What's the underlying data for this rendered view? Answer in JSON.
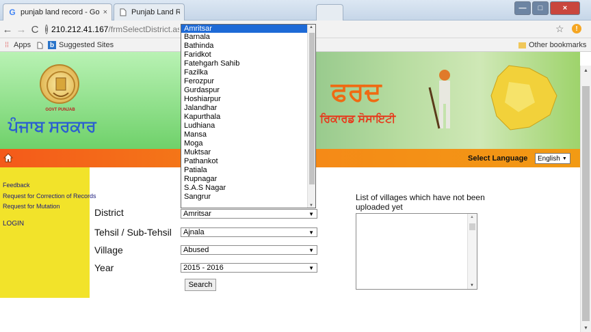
{
  "browser": {
    "tabs": [
      {
        "icon": "G",
        "label": "punjab land record - Go",
        "close": "×"
      },
      {
        "icon": "page",
        "label": "Punjab Land Record"
      }
    ],
    "window_controls": {
      "minimize": "—",
      "maximize": "□",
      "close": "×"
    },
    "url_host": "210.212.41.167",
    "url_path": "/frmSelectDistrict.asp",
    "bookmarks": [
      "Apps",
      "Suggested Sites"
    ],
    "other_bookmarks": "Other bookmarks"
  },
  "header": {
    "left_script": "ਪੰਜਾਬ ਸਰਕਾਰ",
    "right_script_top": "ਫਰਦ",
    "right_script_bottom": "ਰਿਕਾਰਡ ਸੋਸਾਇਟੀ",
    "emblem_caption": "GOVT PUNJAB"
  },
  "nav": {
    "select_language_label": "Select Language",
    "language_value": "English"
  },
  "sidebar": {
    "links": [
      "Feedback",
      "Request for Correction of Records",
      "Request for Mutation"
    ],
    "login": "LOGIN"
  },
  "form": {
    "district_label": "District",
    "district_value": "Amritsar",
    "tehsil_label": "Tehsil / Sub-Tehsil",
    "tehsil_value": "Ajnala",
    "village_label": "Village",
    "village_value": "Abused",
    "year_label": "Year",
    "year_value": "2015 - 2016",
    "search_button": "Search"
  },
  "villages_panel": {
    "title": "List of villages which have not been uploaded yet"
  },
  "district_dropdown": {
    "selected": "Amritsar",
    "options": [
      "Amritsar",
      "Barnala",
      "Bathinda",
      "Faridkot",
      "Fatehgarh Sahib",
      "Fazilka",
      "Ferozpur",
      "Gurdaspur",
      "Hoshiarpur",
      "Jalandhar",
      "Kapurthala",
      "Ludhiana",
      "Mansa",
      "Moga",
      "Muktsar",
      "Pathankot",
      "Patiala",
      "Rupnagar",
      "S.A.S Nagar",
      "Sangrur"
    ]
  }
}
